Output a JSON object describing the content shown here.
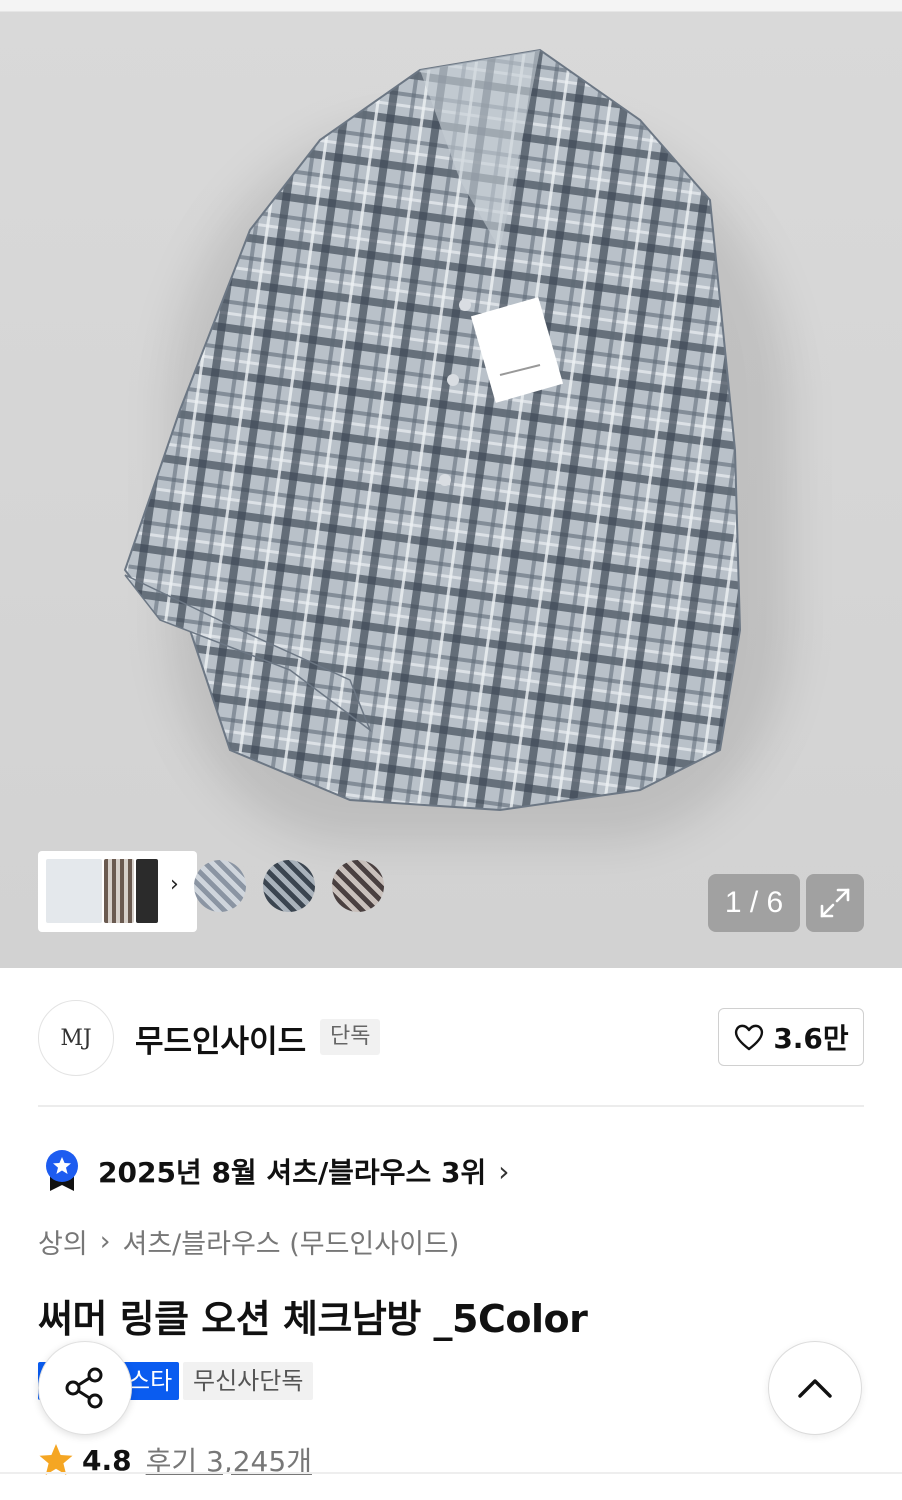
{
  "gallery": {
    "pager": "1 / 6",
    "expand_icon": "expand-icon",
    "swatch_colors": [
      "#8b95a3",
      "#3b4550",
      "#4a4040"
    ]
  },
  "brand": {
    "name": "무드인사이드",
    "logo_text": "MJ",
    "badge": "단독",
    "likes": "3.6만"
  },
  "ranking": {
    "text": "2025년 8월 셔츠/블라우스 3위"
  },
  "breadcrumb": {
    "level1": "상의",
    "level2": "셔츠/블라우스 (무드인사이드)"
  },
  "product": {
    "title": "써머 링클 오션 체크남방 _5Color",
    "tag_primary": "스타",
    "tag_secondary": "무신사단독",
    "rating": "4.8",
    "review_label": "후기 3,245개"
  },
  "colors": {
    "accent_blue": "#0a5cf0",
    "star": "#f5a623"
  }
}
